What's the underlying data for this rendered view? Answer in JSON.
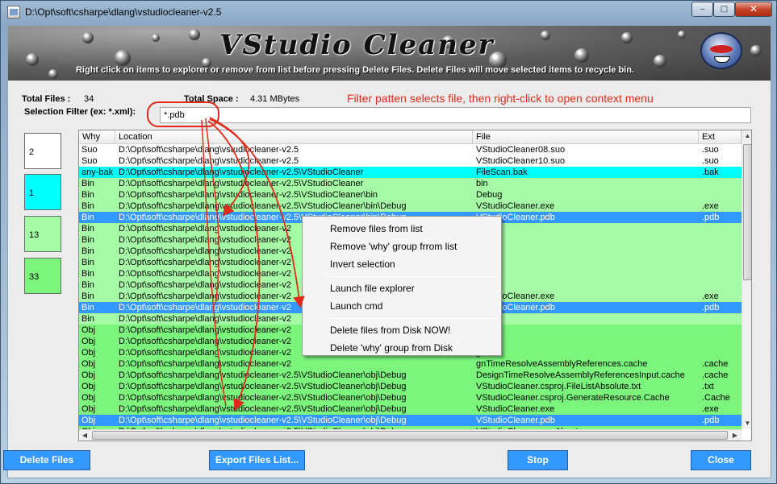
{
  "window": {
    "title": "D:\\Opt\\soft\\csharpe\\dlang\\vstudiocleaner-v2.5",
    "min_glyph": "‒",
    "max_glyph": "□",
    "close_glyph": "✕"
  },
  "banner": {
    "title": "VStudio Cleaner",
    "subtitle": "Right click on items to explorer or remove from list before pressing Delete Files.  Delete Files will move selected items to recycle bin."
  },
  "stats": {
    "total_files_label": "Total Files :",
    "total_files_value": "34",
    "total_space_label": "Total Space :",
    "total_space_value": "4.31 MBytes"
  },
  "filter": {
    "label": "Selection Filter (ex: *.xml):",
    "value": "*.pdb"
  },
  "annotation": "Filter patten selects file, then right-click to open context menu",
  "count_boxes": [
    {
      "value": "2",
      "color": "#ffffff"
    },
    {
      "value": "1",
      "color": "#00ffff"
    },
    {
      "value": "13",
      "color": "#a6fca6"
    },
    {
      "value": "33",
      "color": "#7cf57c"
    }
  ],
  "columns": [
    "Why",
    "Location",
    "File",
    "Ext"
  ],
  "rows": [
    {
      "why": "Suo",
      "location": "D:\\Opt\\soft\\csharpe\\dlang\\vstudiocleaner-v2.5",
      "file": "VStudioCleaner08.suo",
      "ext": ".suo",
      "style": "white"
    },
    {
      "why": "Suo",
      "location": "D:\\Opt\\soft\\csharpe\\dlang\\vstudiocleaner-v2.5",
      "file": "VStudioCleaner10.suo",
      "ext": ".suo",
      "style": "white"
    },
    {
      "why": "any-bak",
      "location": "D:\\Opt\\soft\\csharpe\\dlang\\vstudiocleaner-v2.5\\VStudioCleaner",
      "file": "FileScan.bak",
      "ext": ".bak",
      "style": "cyan"
    },
    {
      "why": "Bin",
      "location": "D:\\Opt\\soft\\csharpe\\dlang\\vstudiocleaner-v2.5\\VStudioCleaner",
      "file": "bin",
      "ext": "",
      "style": "lightgreen"
    },
    {
      "why": "Bin",
      "location": "D:\\Opt\\soft\\csharpe\\dlang\\vstudiocleaner-v2.5\\VStudioCleaner\\bin",
      "file": "Debug",
      "ext": "",
      "style": "lightgreen"
    },
    {
      "why": "Bin",
      "location": "D:\\Opt\\soft\\csharpe\\dlang\\vstudiocleaner-v2.5\\VStudioCleaner\\bin\\Debug",
      "file": "VStudioCleaner.exe",
      "ext": ".exe",
      "style": "lightgreen"
    },
    {
      "why": "Bin",
      "location": "D:\\Opt\\soft\\csharpe\\dlang\\vstudiocleaner-v2.5\\VStudioCleaner\\bin\\Debug",
      "file": "VStudioCleaner.pdb",
      "ext": ".pdb",
      "style": "selected"
    },
    {
      "why": "Bin",
      "location": "D:\\Opt\\soft\\csharpe\\dlang\\vstudiocleaner-v2",
      "file": "se",
      "ext": "",
      "style": "lightgreen"
    },
    {
      "why": "Bin",
      "location": "D:\\Opt\\soft\\csharpe\\dlang\\vstudiocleaner-v2",
      "file": "",
      "ext": "",
      "style": "lightgreen"
    },
    {
      "why": "Bin",
      "location": "D:\\Opt\\soft\\csharpe\\dlang\\vstudiocleaner-v2",
      "file": "g",
      "ext": "",
      "style": "lightgreen"
    },
    {
      "why": "Bin",
      "location": "D:\\Opt\\soft\\csharpe\\dlang\\vstudiocleaner-v2",
      "file": "g",
      "ext": "",
      "style": "lightgreen"
    },
    {
      "why": "Bin",
      "location": "D:\\Opt\\soft\\csharpe\\dlang\\vstudiocleaner-v2",
      "file": "",
      "ext": "",
      "style": "lightgreen"
    },
    {
      "why": "Bin",
      "location": "D:\\Opt\\soft\\csharpe\\dlang\\vstudiocleaner-v2",
      "file": "g",
      "ext": "",
      "style": "lightgreen"
    },
    {
      "why": "Bin",
      "location": "D:\\Opt\\soft\\csharpe\\dlang\\vstudiocleaner-v2",
      "file": "VStudioCleaner.exe",
      "ext": ".exe",
      "style": "lightgreen"
    },
    {
      "why": "Bin",
      "location": "D:\\Opt\\soft\\csharpe\\dlang\\vstudiocleaner-v2",
      "file": "VStudioCleaner.pdb",
      "ext": ".pdb",
      "style": "selected"
    },
    {
      "why": "Bin",
      "location": "D:\\Opt\\soft\\csharpe\\dlang\\vstudiocleaner-v2",
      "file": "",
      "ext": "",
      "style": "lightgreen"
    },
    {
      "why": "Obj",
      "location": "D:\\Opt\\soft\\csharpe\\dlang\\vstudiocleaner-v2",
      "file": "",
      "ext": "",
      "style": "green"
    },
    {
      "why": "Obj",
      "location": "D:\\Opt\\soft\\csharpe\\dlang\\vstudiocleaner-v2",
      "file": "",
      "ext": "",
      "style": "green"
    },
    {
      "why": "Obj",
      "location": "D:\\Opt\\soft\\csharpe\\dlang\\vstudiocleaner-v2",
      "file": "g",
      "ext": "",
      "style": "green"
    },
    {
      "why": "Obj",
      "location": "D:\\Opt\\soft\\csharpe\\dlang\\vstudiocleaner-v2",
      "file": "gnTimeResolveAssemblyReferences.cache",
      "ext": ".cache",
      "style": "green"
    },
    {
      "why": "Obj",
      "location": "D:\\Opt\\soft\\csharpe\\dlang\\vstudiocleaner-v2.5\\VStudioCleaner\\obj\\Debug",
      "file": "DesignTimeResolveAssemblyReferencesInput.cache",
      "ext": ".cache",
      "style": "green"
    },
    {
      "why": "Obj",
      "location": "D:\\Opt\\soft\\csharpe\\dlang\\vstudiocleaner-v2.5\\VStudioCleaner\\obj\\Debug",
      "file": "VStudioCleaner.csproj.FileListAbsolute.txt",
      "ext": ".txt",
      "style": "green"
    },
    {
      "why": "Obj",
      "location": "D:\\Opt\\soft\\csharpe\\dlang\\vstudiocleaner-v2.5\\VStudioCleaner\\obj\\Debug",
      "file": "VStudioCleaner.csproj.GenerateResource.Cache",
      "ext": ".Cache",
      "style": "green"
    },
    {
      "why": "Obj",
      "location": "D:\\Opt\\soft\\csharpe\\dlang\\vstudiocleaner-v2.5\\VStudioCleaner\\obj\\Debug",
      "file": "VStudioCleaner.exe",
      "ext": ".exe",
      "style": "green"
    },
    {
      "why": "Obj",
      "location": "D:\\Opt\\soft\\csharpe\\dlang\\vstudiocleaner-v2.5\\VStudioCleaner\\obj\\Debug",
      "file": "VStudioCleaner.pdb",
      "ext": ".pdb",
      "style": "selected"
    },
    {
      "why": "Obj",
      "location": "D:\\Opt\\soft\\csharpe\\dlang\\vstudiocleaner-v2.5\\VStudioCleaner\\obj\\Debug",
      "file": "VStudioCleaner_ns.About.resources",
      "ext": ".resources",
      "style": "green"
    }
  ],
  "row_colors": {
    "white": {
      "bg": "#ffffff",
      "fg": "#000000"
    },
    "cyan": {
      "bg": "#00ffff",
      "fg": "#000000"
    },
    "lightgreen": {
      "bg": "#a6fca6",
      "fg": "#000000"
    },
    "green": {
      "bg": "#7cf57c",
      "fg": "#000000"
    },
    "selected": {
      "bg": "#3399ff",
      "fg": "#ffffff"
    }
  },
  "context_menu": {
    "items": [
      "Remove files from list",
      "Remove 'why' group frrom list",
      "Invert selection",
      "Launch file explorer",
      "Launch cmd",
      "Delete files from Disk NOW!",
      "Delete 'why' group from Disk"
    ]
  },
  "buttons": {
    "delete_files": "Delete Files",
    "export_list": "Export Files List...",
    "stop": "Stop",
    "close": "Close"
  },
  "colors": {
    "accent": "#3399ff",
    "annotation": "#e02b1a"
  }
}
